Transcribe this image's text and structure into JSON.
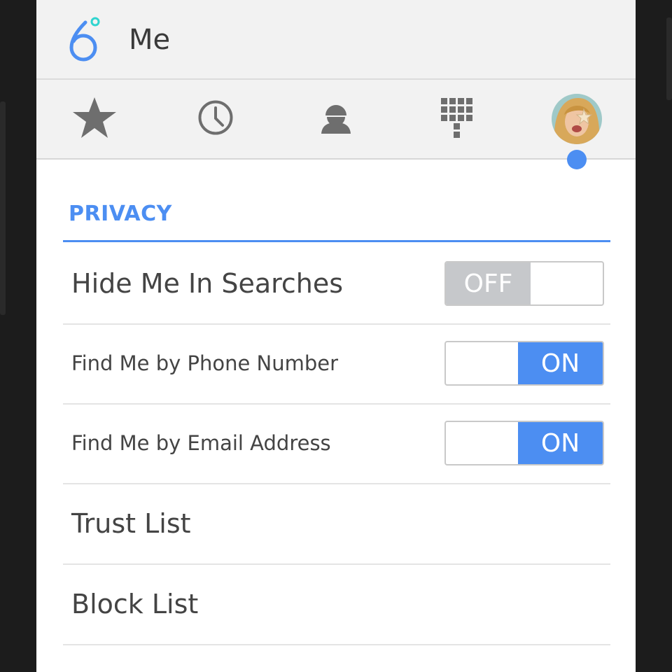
{
  "app": {
    "title": "Me",
    "accent_color": "#4c8ef2",
    "logo_icon": "six-logo-icon"
  },
  "tabs": [
    {
      "name": "favorites",
      "icon": "star-icon"
    },
    {
      "name": "recents",
      "icon": "clock-icon"
    },
    {
      "name": "contacts",
      "icon": "person-icon"
    },
    {
      "name": "dialpad",
      "icon": "dialpad-icon"
    },
    {
      "name": "me",
      "icon": "avatar-icon",
      "selected": true
    }
  ],
  "privacy": {
    "section_title": "PRIVACY",
    "hide_in_searches": {
      "label": "Hide Me In Searches",
      "state": "OFF"
    },
    "find_by_phone": {
      "label": "Find Me by Phone Number",
      "state": "ON"
    },
    "find_by_email": {
      "label": "Find Me by Email Address",
      "state": "ON"
    },
    "trust_list": {
      "label": "Trust List"
    },
    "block_list": {
      "label": "Block List"
    }
  }
}
